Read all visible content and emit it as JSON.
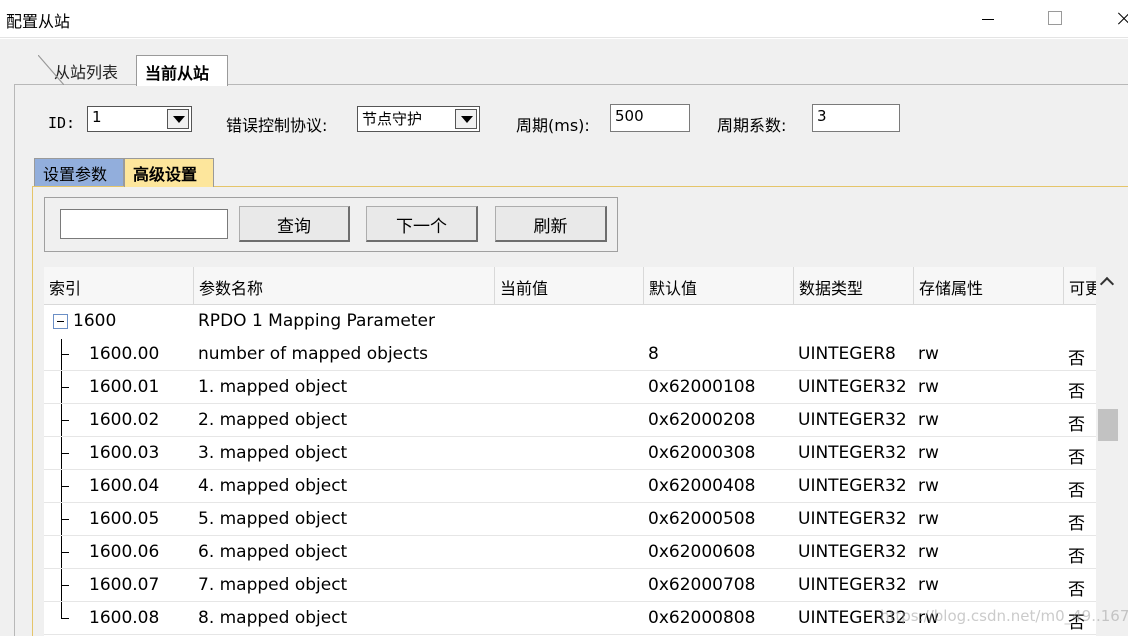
{
  "window": {
    "title": "配置从站"
  },
  "outer_tabs": [
    "从站列表",
    "当前从站"
  ],
  "form": {
    "id_label": "ID:",
    "id_value": "1",
    "protocol_label": "错误控制协议:",
    "protocol_value": "节点守护",
    "period_label": "周期(ms):",
    "period_value": "500",
    "factor_label": "周期系数:",
    "factor_value": "3"
  },
  "inner_tabs": [
    "设置参数",
    "高级设置"
  ],
  "search": {
    "value": "",
    "query_label": "查询",
    "next_label": "下一个",
    "refresh_label": "刷新"
  },
  "table": {
    "columns": [
      "索引",
      "参数名称",
      "当前值",
      "默认值",
      "数据类型",
      "存储属性",
      "可更"
    ],
    "parent": {
      "index": "1600",
      "name": "RPDO 1 Mapping Parameter"
    },
    "rows": [
      {
        "index": "1600.00",
        "name": "number of mapped objects",
        "current": "",
        "default": "8",
        "type": "UINTEGER8",
        "storage": "rw",
        "flag": "否"
      },
      {
        "index": "1600.01",
        "name": "1. mapped object",
        "current": "",
        "default": "0x62000108",
        "type": "UINTEGER32",
        "storage": "rw",
        "flag": "否"
      },
      {
        "index": "1600.02",
        "name": "2. mapped object",
        "current": "",
        "default": "0x62000208",
        "type": "UINTEGER32",
        "storage": "rw",
        "flag": "否"
      },
      {
        "index": "1600.03",
        "name": "3. mapped object",
        "current": "",
        "default": "0x62000308",
        "type": "UINTEGER32",
        "storage": "rw",
        "flag": "否"
      },
      {
        "index": "1600.04",
        "name": "4. mapped object",
        "current": "",
        "default": "0x62000408",
        "type": "UINTEGER32",
        "storage": "rw",
        "flag": "否"
      },
      {
        "index": "1600.05",
        "name": "5. mapped object",
        "current": "",
        "default": "0x62000508",
        "type": "UINTEGER32",
        "storage": "rw",
        "flag": "否"
      },
      {
        "index": "1600.06",
        "name": "6. mapped object",
        "current": "",
        "default": "0x62000608",
        "type": "UINTEGER32",
        "storage": "rw",
        "flag": "否"
      },
      {
        "index": "1600.07",
        "name": "7. mapped object",
        "current": "",
        "default": "0x62000708",
        "type": "UINTEGER32",
        "storage": "rw",
        "flag": "否"
      },
      {
        "index": "1600.08",
        "name": "8. mapped object",
        "current": "",
        "default": "0x62000808",
        "type": "UINTEGER32",
        "storage": "rw",
        "flag": "否"
      }
    ]
  },
  "watermark": "https://blog.csdn.net/m0_49..167",
  "colors": {
    "tab_params": "#92aedc",
    "tab_advanced": "#fde69c"
  }
}
